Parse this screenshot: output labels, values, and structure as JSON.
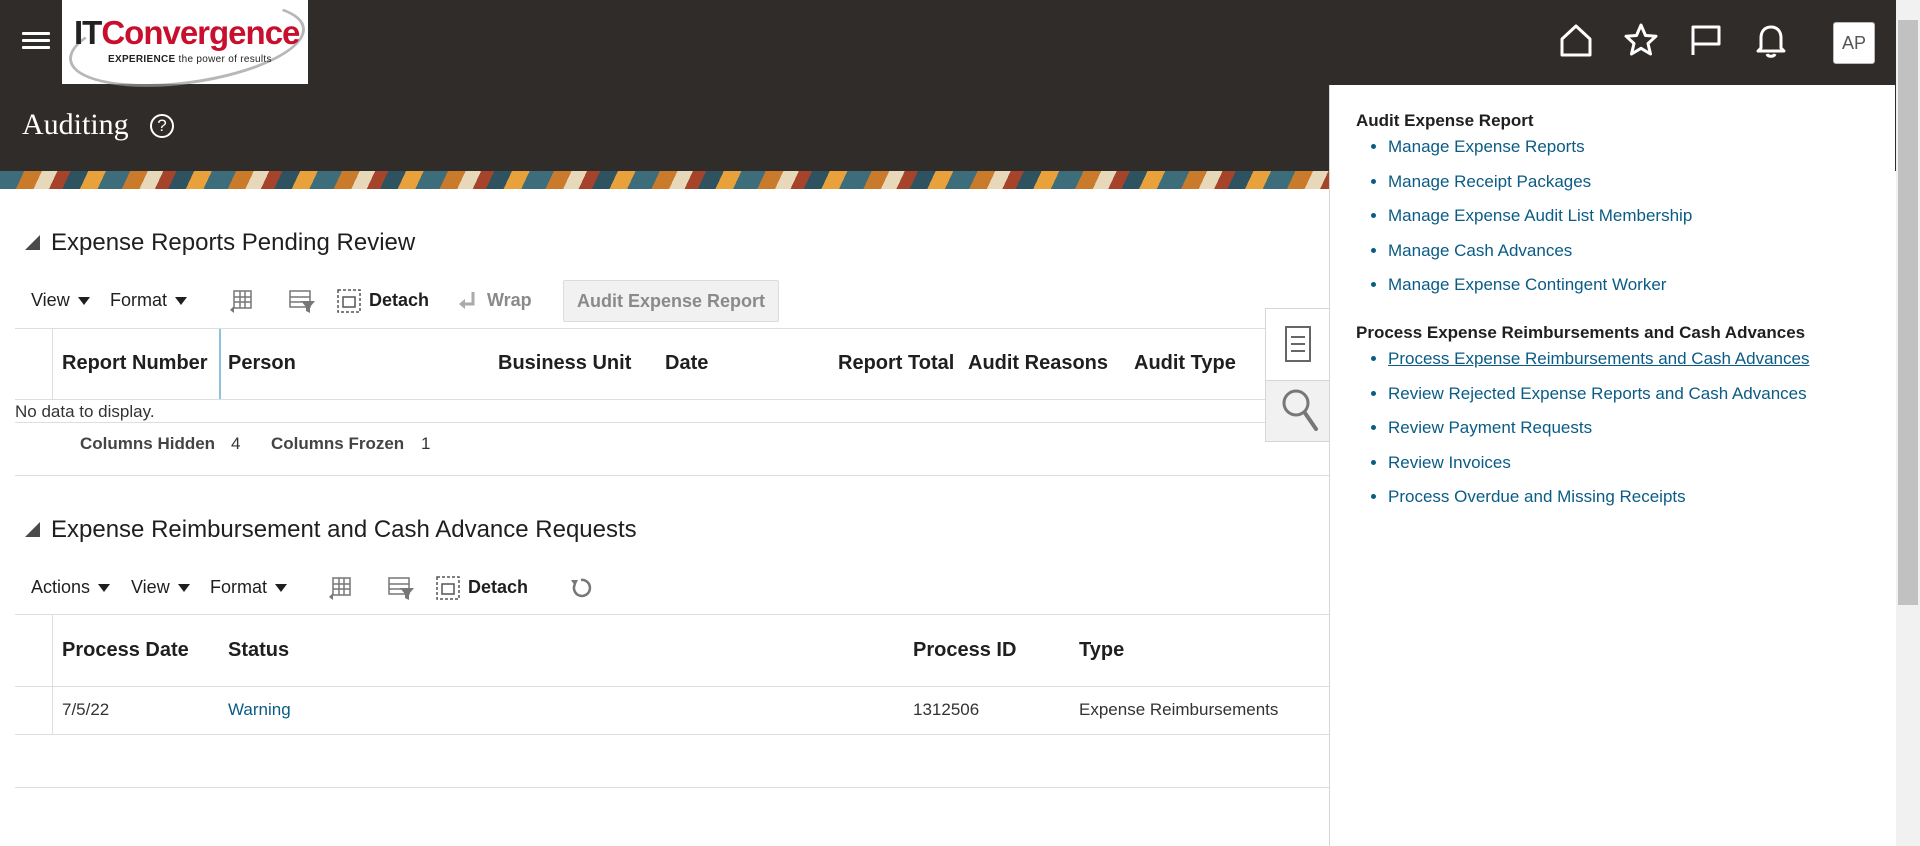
{
  "header": {
    "logo": {
      "brand_it": "IT",
      "brand_name": "Convergence",
      "tag_bold": "EXPERIENCE",
      "tag_rest": " the power of results"
    },
    "page_title": "Auditing",
    "help_symbol": "?",
    "avatar_initials": "AP",
    "icons": [
      "home-icon",
      "star-icon",
      "flag-icon",
      "bell-icon"
    ]
  },
  "section1": {
    "title": "Expense Reports Pending Review",
    "toolbar": {
      "view": "View",
      "format": "Format",
      "detach": "Detach",
      "wrap": "Wrap",
      "audit_button": "Audit Expense Report"
    },
    "columns": [
      "Report Number",
      "Person",
      "Business Unit",
      "Date",
      "Report Total",
      "Audit Reasons",
      "Audit Type"
    ],
    "empty_text": "No data to display.",
    "footer": {
      "hidden_label": "Columns Hidden",
      "hidden_value": "4",
      "frozen_label": "Columns Frozen",
      "frozen_value": "1"
    }
  },
  "section2": {
    "title": "Expense Reimbursement and Cash Advance Requests",
    "toolbar": {
      "actions": "Actions",
      "view": "View",
      "format": "Format",
      "detach": "Detach"
    },
    "columns": [
      "Process Date",
      "Status",
      "Process ID",
      "Type"
    ],
    "rows": [
      {
        "process_date": "7/5/22",
        "status": "Warning",
        "process_id": "1312506",
        "type": "Expense Reimbursements"
      }
    ]
  },
  "tasks_panel": {
    "group1": {
      "heading": "Audit Expense Report",
      "items": [
        "Manage Expense Reports",
        "Manage Receipt Packages",
        "Manage Expense Audit List Membership",
        "Manage Cash Advances",
        "Manage Expense Contingent Worker"
      ]
    },
    "group2": {
      "heading": "Process Expense Reimbursements and Cash Advances",
      "items": [
        "Process Expense Reimbursements and Cash Advances",
        "Review Rejected Expense Reports and Cash Advances",
        "Review Payment Requests",
        "Review Invoices",
        "Process Overdue and Missing Receipts"
      ]
    }
  },
  "colors": {
    "header_bg": "#302c29",
    "link": "#0a5b85"
  }
}
